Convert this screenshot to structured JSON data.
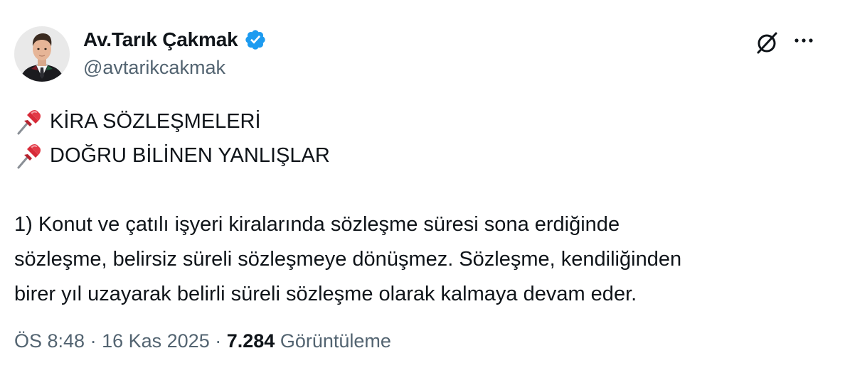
{
  "author": {
    "display_name": "Av.Tarık Çakmak",
    "handle": "@avtarikcakmak",
    "verified": true,
    "verified_color": "#1d9bf0"
  },
  "header_icons": [
    "grok-icon",
    "more-icon"
  ],
  "tweet": {
    "headings": [
      {
        "icon": "pushpin-emoji",
        "text": "KİRA SÖZLEŞMELERİ"
      },
      {
        "icon": "pushpin-emoji",
        "text": "DOĞRU BİLİNEN YANLIŞLAR"
      }
    ],
    "body_lines": [
      "1) Konut ve çatılı işyeri kiralarında sözleşme süresi sona erdiğinde",
      "sözleşme, belirsiz süreli sözleşmeye dönüşmez. Sözleşme, kendiliğinden",
      "birer yıl uzayarak belirli süreli sözleşme olarak kalmaya devam eder."
    ]
  },
  "meta": {
    "time": "ÖS 8:48",
    "separator": "·",
    "date": "16 Kas 2025",
    "views_count": "7.284",
    "views_label": "Görüntüleme"
  },
  "colors": {
    "text": "#0f1419",
    "secondary": "#536471",
    "accent": "#1d9bf0",
    "pin": "#d72a38"
  }
}
